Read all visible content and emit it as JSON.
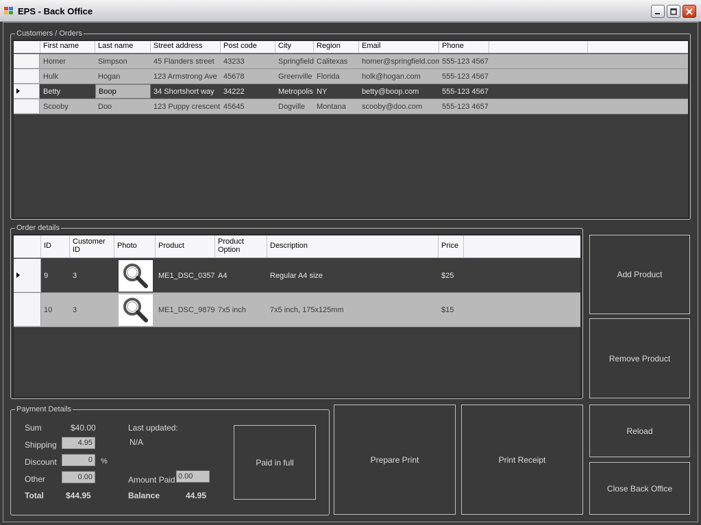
{
  "window": {
    "title": "EPS - Back Office"
  },
  "customers": {
    "group_label": "Customers / Orders",
    "columns": [
      "First name",
      "Last name",
      "Street address",
      "Post code",
      "City",
      "Region",
      "Email",
      "Phone"
    ],
    "rows": [
      [
        "Homer",
        "Simpson",
        "45 Flanders street",
        "43233",
        "Springfield",
        "Calitexas",
        "homer@springfield.com",
        "555-123 4567"
      ],
      [
        "Hulk",
        "Hogan",
        "123 Armstrong Ave",
        "45678",
        "Greenville",
        "Florida",
        "holk@hogan.com",
        "555-123 4567"
      ],
      [
        "Betty",
        "Boop",
        "34 Shortshort way",
        "34222",
        "Metropolis",
        "NY",
        "betty@boop.com",
        "555-123 4567"
      ],
      [
        "Scooby",
        "Doo",
        "123 Puppy crescent",
        "45645",
        "Dogville",
        "Montana",
        "scooby@doo.com",
        "555-123 4657"
      ]
    ],
    "selected_row": 2
  },
  "order_details": {
    "group_label": "Order details",
    "columns": [
      "ID",
      "Customer ID",
      "Photo",
      "Product",
      "Product Option",
      "Description",
      "Price"
    ],
    "rows": [
      {
        "id": "9",
        "customer_id": "3",
        "photo_icon": "magnifier-icon",
        "product": "ME1_DSC_0357",
        "option": "A4",
        "description": "Regular A4 size",
        "price": "$25"
      },
      {
        "id": "10",
        "customer_id": "3",
        "photo_icon": "magnifier-icon",
        "product": "ME1_DSC_9879",
        "option": "7x5 inch",
        "description": "7x5 inch, 175x125mm",
        "price": "$15"
      }
    ]
  },
  "payment": {
    "group_label": "Payment Details",
    "sum_label": "Sum",
    "sum_value": "$40.00",
    "shipping_label": "Shipping",
    "shipping_value": "4.95",
    "discount_label": "Discount",
    "discount_value": "0",
    "discount_unit": "%",
    "other_label": "Other",
    "other_value": "0.00",
    "total_label": "Total",
    "total_value": "$44.95",
    "last_updated_label": "Last updated:",
    "last_updated_value": "N/A",
    "amount_paid_label": "Amount Paid",
    "amount_paid_value": "0.00",
    "balance_label": "Balance",
    "balance_value": "44.95",
    "paid_in_full_label": "Paid in full"
  },
  "buttons": {
    "add_product": "Add Product",
    "remove_product": "Remove Product",
    "prepare_print": "Prepare Print",
    "print_receipt": "Print Receipt",
    "reload": "Reload",
    "close_back_office": "Close Back Office"
  },
  "colors": {
    "background": "#3a3a3a",
    "row_normal": "#b9b9b9",
    "row_selected": "#3e3e3e",
    "header": "#f7f7fb"
  }
}
